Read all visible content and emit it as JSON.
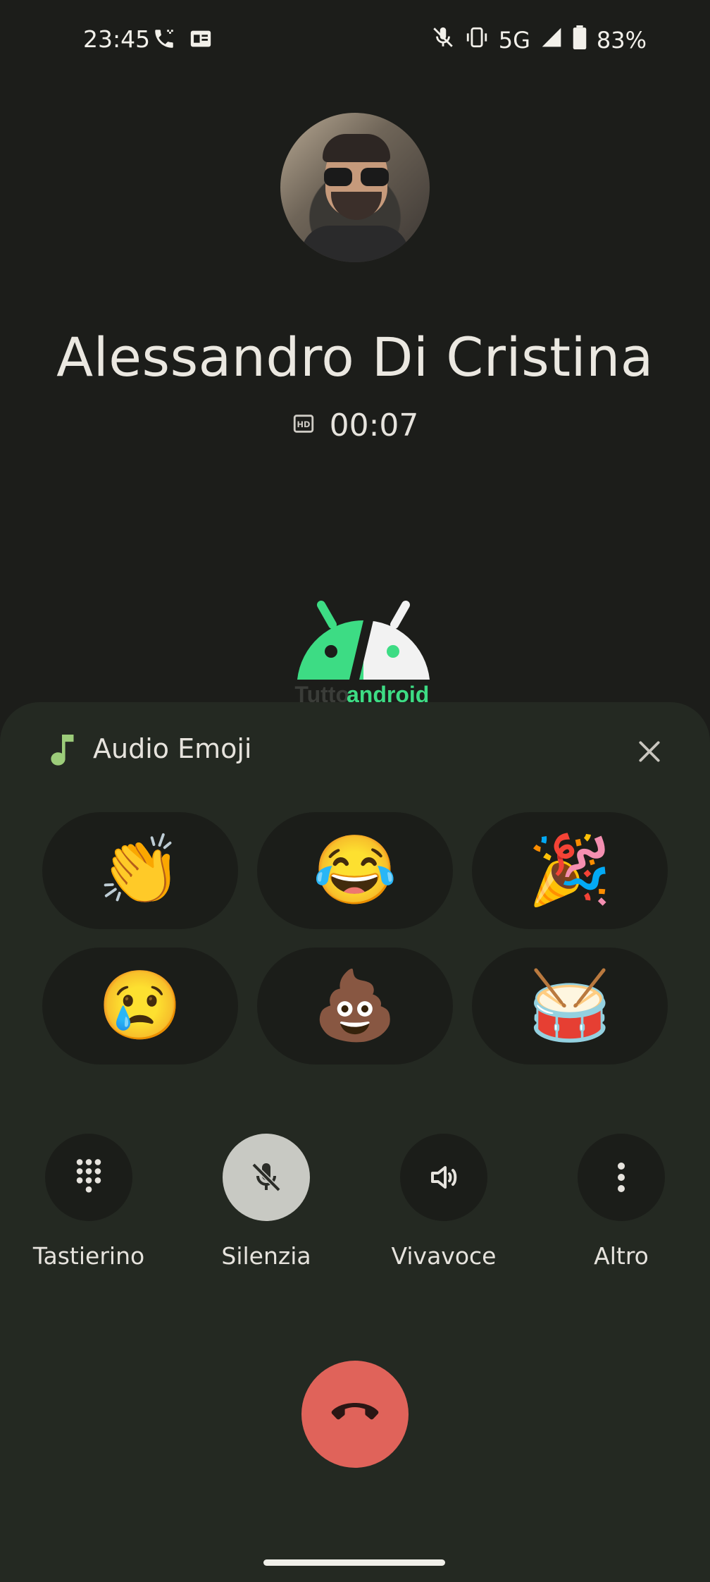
{
  "status_bar": {
    "time": "23:45",
    "network": "5G",
    "battery": "83%",
    "icons_left": [
      "phone-call-icon",
      "gmail-card-icon"
    ],
    "icons_right": [
      "mic-muted-icon",
      "vibrate-icon",
      "signal-icon",
      "battery-icon"
    ]
  },
  "call": {
    "caller_name": "Alessandro Di Cristina",
    "timer": "00:07",
    "hd_badge": "HD"
  },
  "watermark": {
    "left": "Tutto",
    "right": "android",
    "colors": {
      "left": "#3ddc84",
      "right": "#f2f2f2"
    }
  },
  "audio_emoji_sheet": {
    "title": "Audio Emoji",
    "emojis": [
      {
        "emoji": "👏",
        "name": "clapping-hands"
      },
      {
        "emoji": "😂",
        "name": "tears-of-joy"
      },
      {
        "emoji": "🎉",
        "name": "party-popper"
      },
      {
        "emoji": "😢",
        "name": "crying-face"
      },
      {
        "emoji": "💩",
        "name": "pile-of-poo"
      },
      {
        "emoji": "🥁",
        "name": "drum"
      }
    ]
  },
  "controls": [
    {
      "label": "Tastierino",
      "icon": "dialpad-icon",
      "active": false
    },
    {
      "label": "Silenzia",
      "icon": "mic-off-icon",
      "active": true
    },
    {
      "label": "Vivavoce",
      "icon": "speaker-icon",
      "active": false
    },
    {
      "label": "Altro",
      "icon": "more-vert-icon",
      "active": false
    }
  ],
  "colors": {
    "background": "#1c1d1a",
    "sheet": "#242922",
    "hangup": "#e0635a",
    "accent_green": "#9ccc7a"
  }
}
